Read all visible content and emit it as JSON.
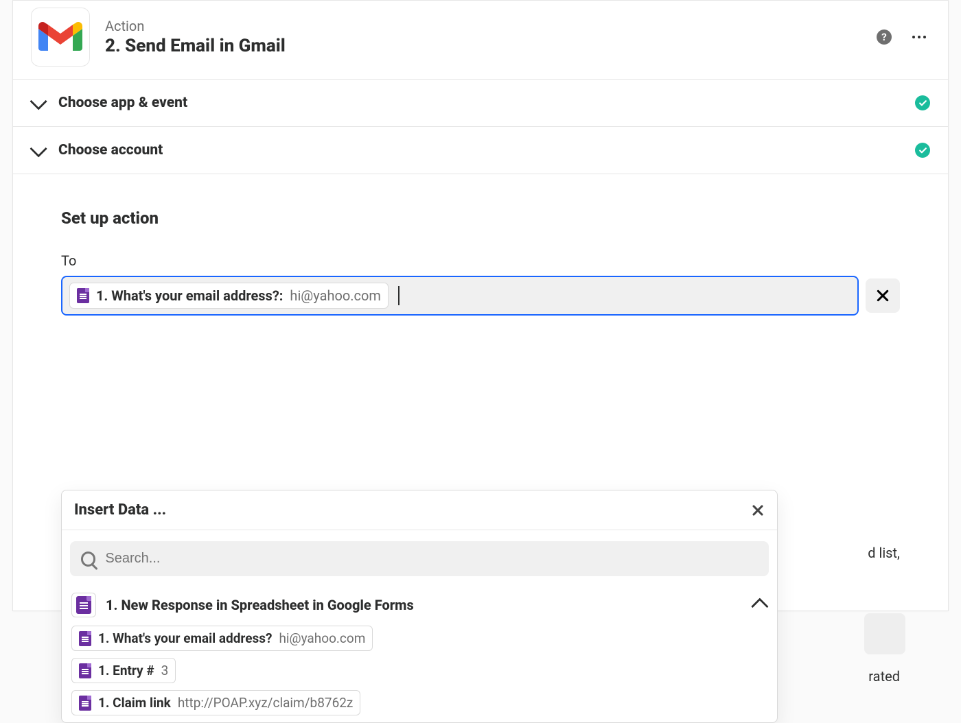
{
  "header": {
    "label": "Action",
    "title": "2. Send Email in Gmail"
  },
  "sections": {
    "app_event": "Choose app & event",
    "account": "Choose account",
    "setup": "Set up action"
  },
  "field": {
    "to_label": "To",
    "token_label": "1. What's your email address?:",
    "token_value": "hi@yahoo.com"
  },
  "dropdown": {
    "title": "Insert Data ...",
    "search_placeholder": "Search...",
    "group_title": "1. New Response in Spreadsheet in Google Forms",
    "items": [
      {
        "label": "1. What's your email address?",
        "value": "hi@yahoo.com"
      },
      {
        "label": "1. Entry #",
        "value": "3"
      },
      {
        "label": "1. Claim link",
        "value": "http://POAP.xyz/claim/b8762z"
      }
    ]
  },
  "background": {
    "hint1": "d list,",
    "hint2": "rated"
  }
}
